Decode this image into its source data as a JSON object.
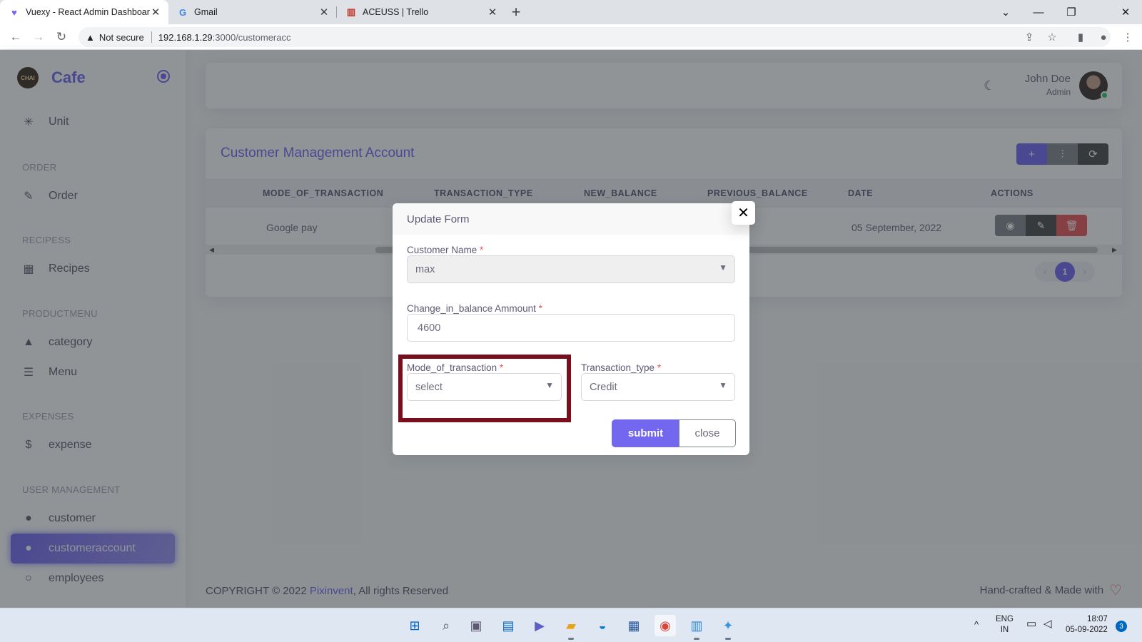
{
  "browser": {
    "tabs": [
      {
        "title": "Vuexy - React Admin Dashboard",
        "active": true
      },
      {
        "title": "Gmail",
        "active": false
      },
      {
        "title": "ACEUSS | Trello",
        "active": false
      }
    ],
    "security_label": "Not secure",
    "url_host": "192.168.1.29",
    "url_path": ":3000/customeracc"
  },
  "sidebar": {
    "brand": "Cafe",
    "logo_text": "CHAI",
    "items": {
      "unit": "Unit",
      "order_header": "ORDER",
      "order": "Order",
      "recipes_header": "RECIPESS",
      "recipes": "Recipes",
      "productmenu_header": "PRODUCTMENU",
      "category": "category",
      "menu": "Menu",
      "expenses_header": "EXPENSES",
      "expense": "expense",
      "user_header": "USER MANAGEMENT",
      "customer": "customer",
      "customeraccount": "customeraccount",
      "employees": "employees"
    }
  },
  "header": {
    "user_name": "John Doe",
    "user_role": "Admin"
  },
  "card": {
    "title": "Customer Management Account",
    "columns": [
      "MODE_OF_TRANSACTION",
      "TRANSACTION_TYPE",
      "NEW_BALANCE",
      "PREVIOUS_BALANCE",
      "DATE",
      "ACTIONS"
    ],
    "rows": [
      {
        "mode": "Google pay",
        "date": "05 September, 2022"
      }
    ],
    "current_page": "1"
  },
  "footer": {
    "copyright_prefix": "COPYRIGHT © 2022 ",
    "company": "Pixinvent",
    "rights": ", All rights Reserved",
    "right_text": "Hand-crafted & Made with"
  },
  "modal": {
    "title": "Update Form",
    "customer_name_label": "Customer Name",
    "customer_name_value": "max",
    "amount_label": "Change_in_balance Ammount",
    "amount_value": "4600",
    "mode_label": "Mode_of_transaction",
    "mode_value": "select",
    "type_label": "Transaction_type",
    "type_value": "Credit",
    "required_mark": "*",
    "submit": "submit",
    "close": "close"
  },
  "taskbar": {
    "lang_top": "ENG",
    "lang_bottom": "IN",
    "time": "18:07",
    "date": "05-09-2022",
    "notifications": "3"
  },
  "colors": {
    "primary": "#7367f0",
    "danger": "#ea5455",
    "highlight_box": "#7b0e1d"
  }
}
